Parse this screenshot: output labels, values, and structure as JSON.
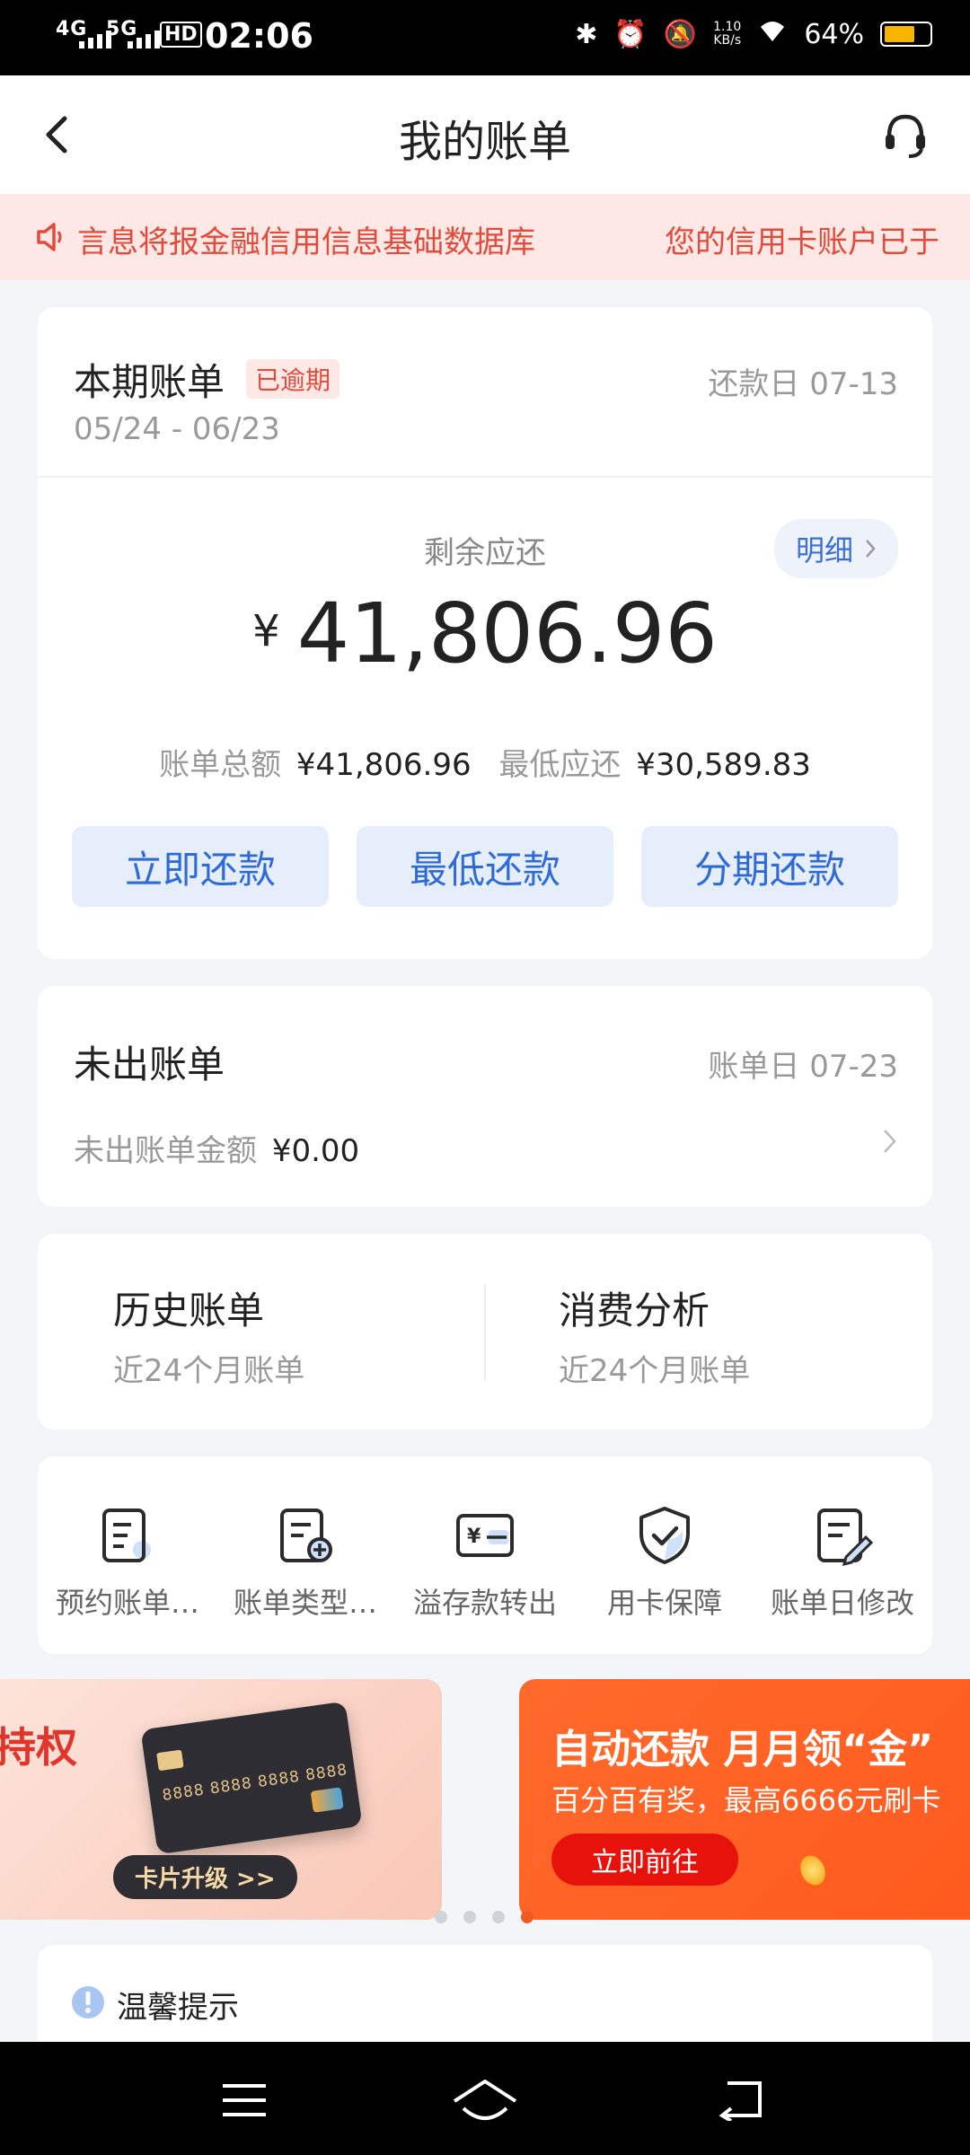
{
  "status_bar": {
    "network_left": "4G",
    "network_right": "5G",
    "hd": "HD",
    "time": "02:06",
    "speed_value": "1.10",
    "speed_unit": "KB/s",
    "battery": "64%"
  },
  "header": {
    "title": "我的账单"
  },
  "notice": {
    "text1": "言息将报金融信用信息基础数据库",
    "text2": "您的信用卡账户已于"
  },
  "current_bill": {
    "title": "本期账单",
    "badge": "已逾期",
    "repay_day": "还款日 07-13",
    "period": "05/24 - 06/23",
    "remaining_label": "剩余应还",
    "detail_label": "明细",
    "currency": "¥",
    "amount": "41,806.96",
    "total_label": "账单总额",
    "total_value": "¥41,806.96",
    "min_label": "最低应还",
    "min_value": "¥30,589.83",
    "buttons": {
      "repay_now": "立即还款",
      "repay_min": "最低还款",
      "repay_installment": "分期还款"
    }
  },
  "unbilled": {
    "title": "未出账单",
    "bill_day": "账单日 07-23",
    "amount_label": "未出账单金额",
    "amount_value": "¥0.00"
  },
  "history": {
    "history_title": "历史账单",
    "history_sub": "近24个月账单",
    "analysis_title": "消费分析",
    "analysis_sub": "近24个月账单"
  },
  "quick_actions": [
    {
      "label": "预约账单…",
      "icon": "reserve-bill-icon"
    },
    {
      "label": "账单类型…",
      "icon": "bill-type-icon"
    },
    {
      "label": "溢存款转出",
      "icon": "overpayment-transfer-icon"
    },
    {
      "label": "用卡保障",
      "icon": "card-protection-icon"
    },
    {
      "label": "账单日修改",
      "icon": "bill-day-edit-icon"
    }
  ],
  "banners": {
    "left_title": "持权",
    "left_card_number": "8888 8888 8888 8888",
    "left_button": "卡片升级 >>",
    "right_title": "自动还款 月月领“金”",
    "right_sub": "百分百有奖，最高6666元刷卡",
    "right_button": "立即前往"
  },
  "tips": {
    "title": "温馨提示"
  },
  "colors": {
    "accent_blue": "#2f6bd6",
    "alert_red": "#e24b3b",
    "banner_orange": "#ff6a2b"
  }
}
